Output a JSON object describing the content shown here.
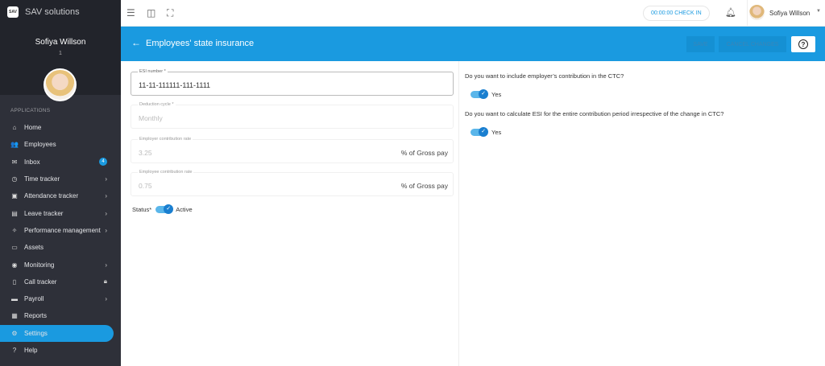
{
  "brand": {
    "logo_text": "SAV",
    "name": "SAV solutions"
  },
  "user": {
    "name": "Sofiya Willson",
    "id": "1"
  },
  "sidebar": {
    "section": "APPLICATIONS",
    "items": [
      {
        "label": "Home",
        "icon": "⌂"
      },
      {
        "label": "Employees",
        "icon": "👥"
      },
      {
        "label": "Inbox",
        "icon": "✉",
        "badge": "4"
      },
      {
        "label": "Time tracker",
        "icon": "◷",
        "chevron": true
      },
      {
        "label": "Attendance tracker",
        "icon": "▣",
        "chevron": true
      },
      {
        "label": "Leave tracker",
        "icon": "▤",
        "chevron": true
      },
      {
        "label": "Performance management",
        "icon": "✧",
        "chevron": true
      },
      {
        "label": "Assets",
        "icon": "▭"
      },
      {
        "label": "Monitoring",
        "icon": "◉",
        "chevron": true
      },
      {
        "label": "Call tracker",
        "icon": "▯",
        "lock": true
      },
      {
        "label": "Payroll",
        "icon": "▬",
        "chevron": true
      },
      {
        "label": "Reports",
        "icon": "▦"
      },
      {
        "label": "Settings",
        "icon": "⚙",
        "active": true
      },
      {
        "label": "Help",
        "icon": "?"
      }
    ]
  },
  "topbar": {
    "checkin": "00:00:00 CHECK IN",
    "user_name": "Sofiya Willson"
  },
  "header": {
    "title": "Employees' state insurance",
    "save": "SAVE",
    "cancel": "CANCEL CHANGES",
    "help": "?"
  },
  "form": {
    "esi": {
      "label": "ESI number *",
      "value": "11-11-111111-111-1111"
    },
    "cycle": {
      "label": "Deduction cycle *",
      "value": "Monthly"
    },
    "employer": {
      "label": "Employer contribution rate",
      "value": "3.25",
      "unit": "% of Gross pay"
    },
    "employee": {
      "label": "Employee contribution rate",
      "value": "0.75",
      "unit": "% of Gross pay"
    },
    "status": {
      "label": "Status*",
      "value": "Active",
      "on": true
    }
  },
  "options": {
    "q1": {
      "text": "Do you want to include employer’s contribution in the CTC?",
      "answer": "Yes",
      "on": true
    },
    "q2": {
      "text": "Do you want to calculate ESI for the entire contribution period irrespective of the change in CTC?",
      "answer": "Yes",
      "on": true
    }
  },
  "colors": {
    "accent": "#1a9ae0",
    "sidebar": "#2e3039"
  }
}
